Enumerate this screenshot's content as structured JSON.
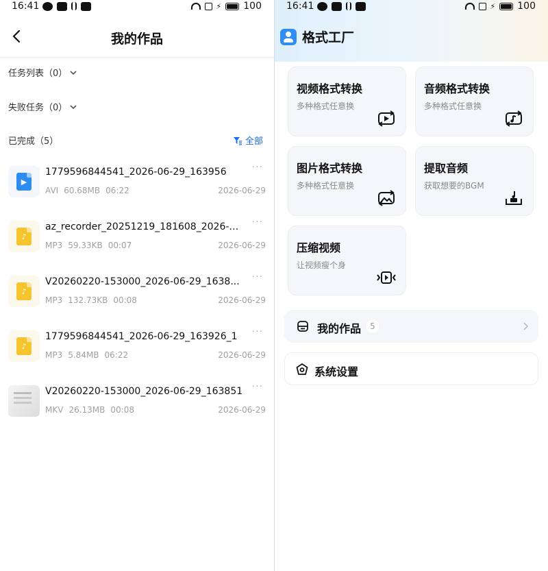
{
  "status_bar": {
    "time": "16:41",
    "battery": "100"
  },
  "left": {
    "title": "我的作品",
    "task_list_label": "任务列表（0）",
    "failed_tasks_label": "失败任务（0）",
    "completed_label": "已完成（5）",
    "filter_label": "全部",
    "files": [
      {
        "name": "1779596844541_2026-06-29_163956",
        "format": "AVI",
        "size": "60.68MB",
        "duration": "06:22",
        "date": "2026-06-29",
        "icon": "video-file-icon"
      },
      {
        "name": "az_recorder_20251219_181608_2026-0...",
        "format": "MP3",
        "size": "59.33KB",
        "duration": "00:07",
        "date": "2026-06-29",
        "icon": "audio-file-icon"
      },
      {
        "name": "V20260220-153000_2026-06-29_1638...",
        "format": "MP3",
        "size": "132.73KB",
        "duration": "00:08",
        "date": "2026-06-29",
        "icon": "audio-file-icon"
      },
      {
        "name": "1779596844541_2026-06-29_163926_1",
        "format": "MP3",
        "size": "5.84MB",
        "duration": "06:22",
        "date": "2026-06-29",
        "icon": "audio-file-icon"
      },
      {
        "name": "V20260220-153000_2026-06-29_163851",
        "format": "MKV",
        "size": "26.13MB",
        "duration": "00:08",
        "date": "2026-06-29",
        "icon": "image-thumbnail"
      }
    ],
    "more_glyph": "···"
  },
  "right": {
    "app_title": "格式工厂",
    "cards": [
      {
        "title": "视频格式转换",
        "subtitle": "多种格式任意换",
        "icon": "video-convert-icon"
      },
      {
        "title": "音频格式转换",
        "subtitle": "多种格式任意换",
        "icon": "audio-convert-icon"
      },
      {
        "title": "图片格式转换",
        "subtitle": "多种格式任意换",
        "icon": "image-convert-icon"
      },
      {
        "title": "提取音频",
        "subtitle": "获取想要的BGM",
        "icon": "extract-audio-icon"
      },
      {
        "title": "压缩视频",
        "subtitle": "让视频瘦个身",
        "icon": "compress-video-icon"
      }
    ],
    "my_works_label": "我的作品",
    "my_works_count": "5",
    "settings_label": "系统设置"
  },
  "colors": {
    "accent": "#1e6bf0",
    "card_bg": "#f5f6f9",
    "audio_icon": "#f7c42d",
    "video_icon": "#2d8cf0"
  }
}
